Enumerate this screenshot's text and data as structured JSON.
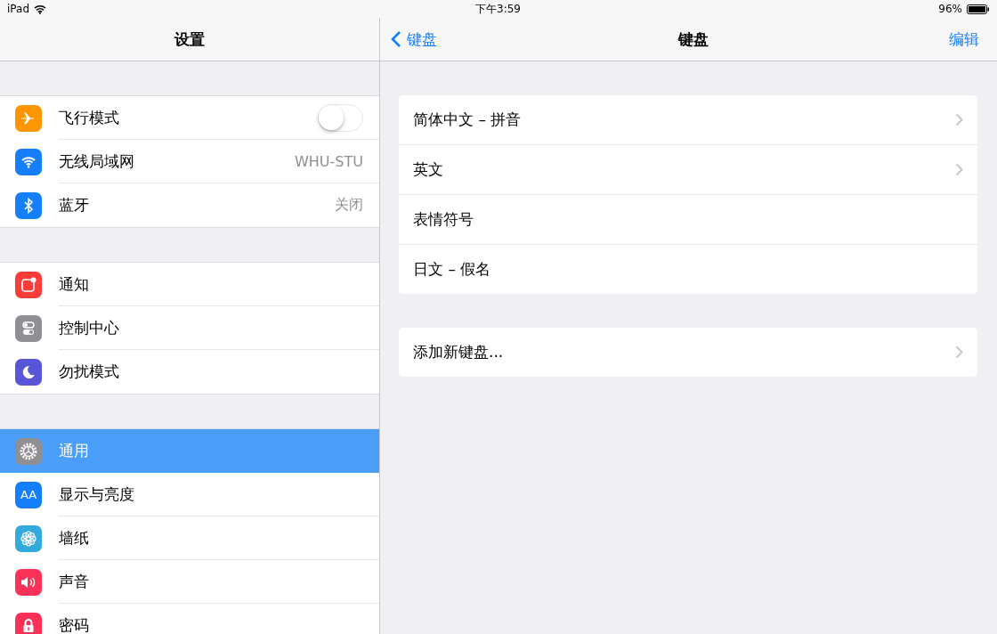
{
  "status_bar": {
    "device": "iPad",
    "time": "下午3:59",
    "battery": "96%"
  },
  "master": {
    "title": "设置",
    "groups": [
      [
        {
          "label": "飞行模式",
          "toggle": {
            "on": false
          },
          "selected": false
        },
        {
          "label": "无线局域网",
          "value": "WHU-STU",
          "selected": false
        },
        {
          "label": "蓝牙",
          "value": "关闭",
          "selected": false
        }
      ],
      [
        {
          "label": "通知",
          "selected": false
        },
        {
          "label": "控制中心",
          "selected": false
        },
        {
          "label": "勿扰模式",
          "selected": false
        }
      ],
      [
        {
          "label": "通用",
          "selected": true
        },
        {
          "label": "显示与亮度",
          "icon_text": "AA",
          "selected": false
        },
        {
          "label": "墙纸",
          "selected": false
        },
        {
          "label": "声音",
          "selected": false
        },
        {
          "label": "密码",
          "selected": false
        }
      ]
    ]
  },
  "detail": {
    "back": "键盘",
    "title": "键盘",
    "action": "编辑",
    "groups": [
      [
        {
          "label": "简体中文 – 拼音",
          "disclosure": true
        },
        {
          "label": "英文",
          "disclosure": true
        },
        {
          "label": "表情符号",
          "disclosure": false
        },
        {
          "label": "日文 – 假名",
          "disclosure": false
        }
      ],
      [
        {
          "label": "添加新键盘...",
          "disclosure": true
        }
      ]
    ]
  }
}
